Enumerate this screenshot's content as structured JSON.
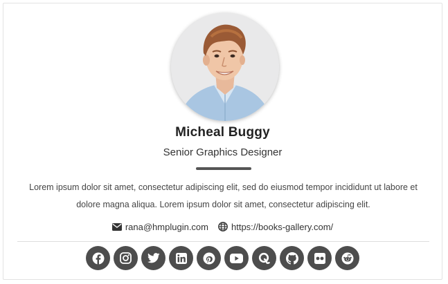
{
  "profile": {
    "name": "Micheal Buggy",
    "title": "Senior Graphics Designer",
    "bio": "Lorem ipsum dolor sit amet, consectetur adipiscing elit, sed do eiusmod tempor incididunt ut labore et dolore magna aliqua. Lorem ipsum dolor sit amet, consectetur adipiscing elit."
  },
  "contacts": {
    "email": "rana@hmplugin.com",
    "website": "https://books-gallery.com/"
  },
  "socials": [
    {
      "icon": "facebook-icon"
    },
    {
      "icon": "instagram-icon"
    },
    {
      "icon": "twitter-icon"
    },
    {
      "icon": "linkedin-icon"
    },
    {
      "icon": "pinterest-icon"
    },
    {
      "icon": "youtube-icon"
    },
    {
      "icon": "quora-icon"
    },
    {
      "icon": "github-icon"
    },
    {
      "icon": "flickr-icon"
    },
    {
      "icon": "reddit-icon"
    }
  ],
  "colors": {
    "accent_bar": "#555555",
    "social_bg": "#4d4d4d",
    "border": "#e2e2e2"
  }
}
